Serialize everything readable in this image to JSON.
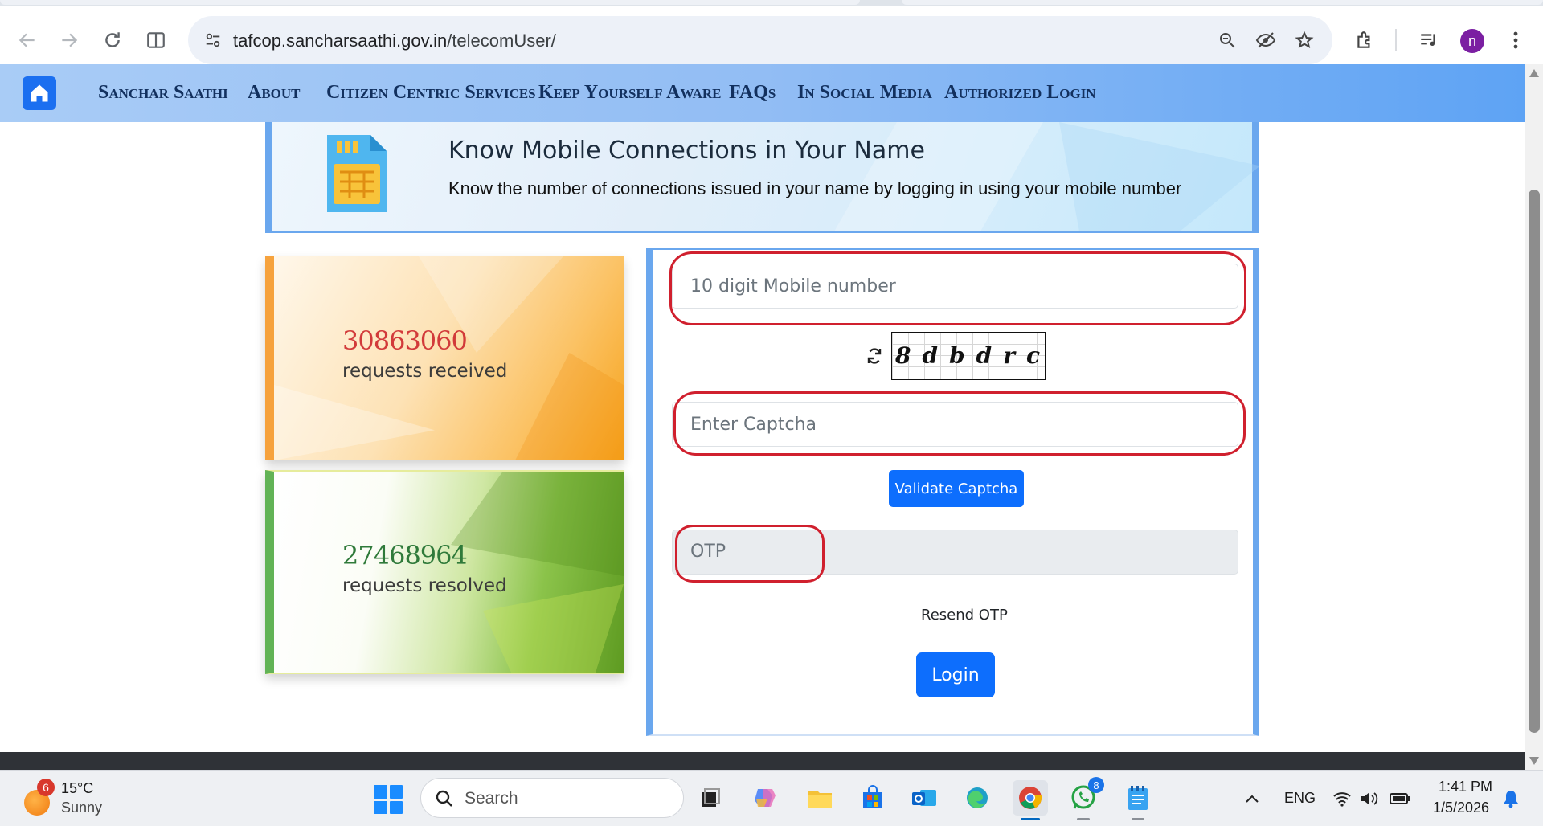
{
  "browser": {
    "url_domain": "tafcop.sancharsaathi.gov.in",
    "url_path": "/telecomUser/",
    "profile_initial": "n"
  },
  "nav": {
    "items": [
      {
        "label": "Sanchar Saathi"
      },
      {
        "label": "About"
      },
      {
        "label": "Citizen Centric Services"
      },
      {
        "label": "Keep Yourself Aware"
      },
      {
        "label": "FAQs"
      },
      {
        "label": "In Social Media"
      },
      {
        "label": "Authorized Login"
      }
    ]
  },
  "banner": {
    "title": "Know Mobile Connections in Your Name",
    "subtitle": "Know the number of connections issued in your name by logging in using your mobile number"
  },
  "stats": {
    "received_count": "30863060",
    "received_label": "requests received",
    "resolved_count": "27468964",
    "resolved_label": "requests resolved"
  },
  "form": {
    "mobile_placeholder": "10 digit Mobile number",
    "captcha_text": "8dbdrc",
    "captcha_placeholder": "Enter Captcha",
    "validate_label": "Validate Captcha",
    "otp_label": "OTP",
    "resend_label": "Resend OTP",
    "login_label": "Login"
  },
  "taskbar": {
    "weather_badge": "6",
    "weather_temp": "15°C",
    "weather_cond": "Sunny",
    "search_placeholder": "Search",
    "whatsapp_badge": "8",
    "language": "ENG",
    "time": "1:41 PM",
    "date": "1/5/2026"
  },
  "colors": {
    "accent_blue": "#0d6efd",
    "nav_text": "#12305e",
    "annotation_red": "#d0202e",
    "received_number": "#d23a3a",
    "resolved_number": "#2f7a3a"
  }
}
